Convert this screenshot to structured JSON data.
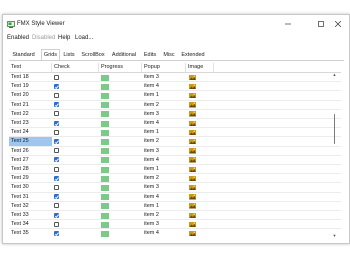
{
  "window": {
    "title": "FMX Style Viewer"
  },
  "menu": [
    "Enabled",
    "Disabled",
    "Help",
    "Load..."
  ],
  "tabs": [
    "Standard",
    "Grids",
    "Lists",
    "ScrollBox",
    "Additional",
    "Edits",
    "Misc",
    "Extended"
  ],
  "active_tab": "Grids",
  "grid": {
    "columns": [
      "Text",
      "Check",
      "Progress",
      "Popup",
      "Image"
    ],
    "selected_row": "Text 25",
    "rows": [
      {
        "text": "Text 18",
        "check": false,
        "popup": "item 3"
      },
      {
        "text": "Text 19",
        "check": true,
        "popup": "item 4"
      },
      {
        "text": "Text 20",
        "check": false,
        "popup": "item 1"
      },
      {
        "text": "Text 21",
        "check": true,
        "popup": "item 2"
      },
      {
        "text": "Text 22",
        "check": false,
        "popup": "item 3"
      },
      {
        "text": "Text 23",
        "check": true,
        "popup": "item 4"
      },
      {
        "text": "Text 24",
        "check": false,
        "popup": "item 1"
      },
      {
        "text": "Text 25",
        "check": true,
        "popup": "item 2"
      },
      {
        "text": "Text 26",
        "check": false,
        "popup": "item 3"
      },
      {
        "text": "Text 27",
        "check": true,
        "popup": "item 4"
      },
      {
        "text": "Text 28",
        "check": false,
        "popup": "item 1"
      },
      {
        "text": "Text 29",
        "check": true,
        "popup": "item 2"
      },
      {
        "text": "Text 30",
        "check": false,
        "popup": "item 3"
      },
      {
        "text": "Text 31",
        "check": true,
        "popup": "item 4"
      },
      {
        "text": "Text 32",
        "check": false,
        "popup": "item 1"
      },
      {
        "text": "Text 33",
        "check": true,
        "popup": "item 2"
      },
      {
        "text": "Text 34",
        "check": false,
        "popup": "item 3"
      },
      {
        "text": "Text 35",
        "check": true,
        "popup": "item 4"
      }
    ]
  },
  "colors": {
    "accent": "#2a6ed6",
    "selection": "#9ec6ef",
    "progress": "#7cc98a"
  },
  "icons": [
    "app-icon",
    "minimize-icon",
    "maximize-icon",
    "close-icon",
    "image-thumbnail-icon",
    "scroll-up-icon",
    "scroll-down-icon"
  ]
}
